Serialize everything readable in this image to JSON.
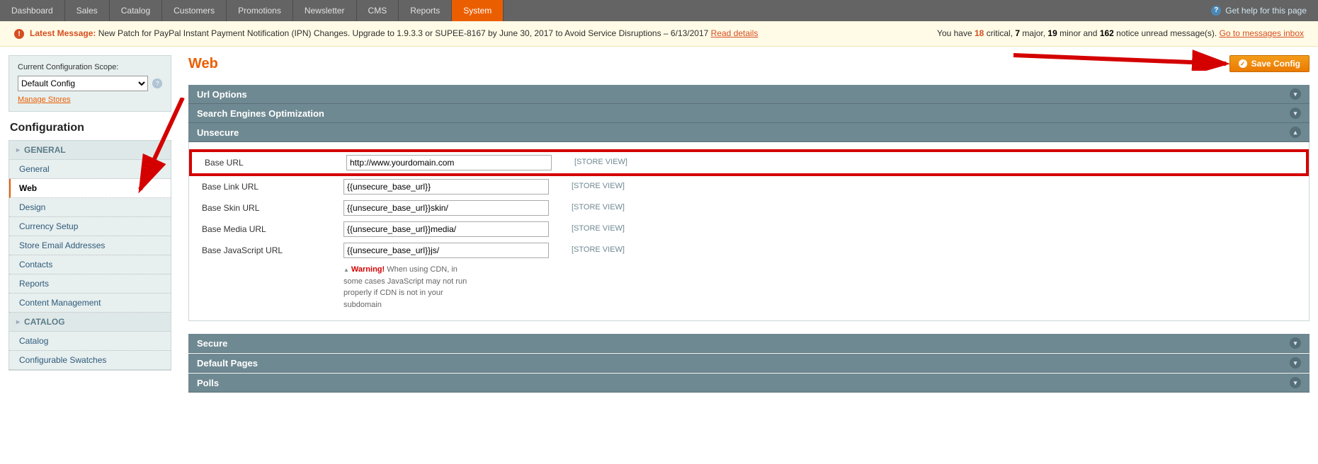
{
  "nav": {
    "items": [
      "Dashboard",
      "Sales",
      "Catalog",
      "Customers",
      "Promotions",
      "Newsletter",
      "CMS",
      "Reports",
      "System"
    ],
    "active": "System",
    "help": "Get help for this page"
  },
  "messages": {
    "latest_label": "Latest Message:",
    "latest_text": "New Patch for PayPal Instant Payment Notification (IPN) Changes. Upgrade to 1.9.3.3 or SUPEE-8167 by June 30, 2017 to Avoid Service Disruptions – 6/13/2017",
    "read_details": "Read details",
    "summary_pre": "You have ",
    "critical": "18",
    "critical_lbl": " critical",
    "major": "7",
    "major_lbl": " major",
    "minor": "19",
    "minor_lbl": " minor and ",
    "notice": "162",
    "notice_lbl": " notice unread message(s). ",
    "inbox_link": "Go to messages inbox"
  },
  "scope": {
    "label": "Current Configuration Scope:",
    "value": "Default Config",
    "manage": "Manage Stores"
  },
  "config_title": "Configuration",
  "menu": {
    "general_head": "GENERAL",
    "general_items": [
      "General",
      "Web",
      "Design",
      "Currency Setup",
      "Store Email Addresses",
      "Contacts",
      "Reports",
      "Content Management"
    ],
    "general_active": "Web",
    "catalog_head": "CATALOG",
    "catalog_items": [
      "Catalog",
      "Configurable Swatches"
    ]
  },
  "main": {
    "title": "Web",
    "save": "Save Config"
  },
  "sections": {
    "url_options": "Url Options",
    "seo": "Search Engines Optimization",
    "unsecure": "Unsecure",
    "secure": "Secure",
    "default_pages": "Default Pages",
    "polls": "Polls"
  },
  "unsecure": {
    "rows": [
      {
        "label": "Base URL",
        "value": "http://www.yourdomain.com",
        "scope": "[STORE VIEW]"
      },
      {
        "label": "Base Link URL",
        "value": "{{unsecure_base_url}}",
        "scope": "[STORE VIEW]"
      },
      {
        "label": "Base Skin URL",
        "value": "{{unsecure_base_url}}skin/",
        "scope": "[STORE VIEW]"
      },
      {
        "label": "Base Media URL",
        "value": "{{unsecure_base_url}}media/",
        "scope": "[STORE VIEW]"
      },
      {
        "label": "Base JavaScript URL",
        "value": "{{unsecure_base_url}}js/",
        "scope": "[STORE VIEW]"
      }
    ],
    "warning_label": "Warning!",
    "warning_text": " When using CDN, in some cases JavaScript may not run properly if CDN is not in your subdomain"
  }
}
